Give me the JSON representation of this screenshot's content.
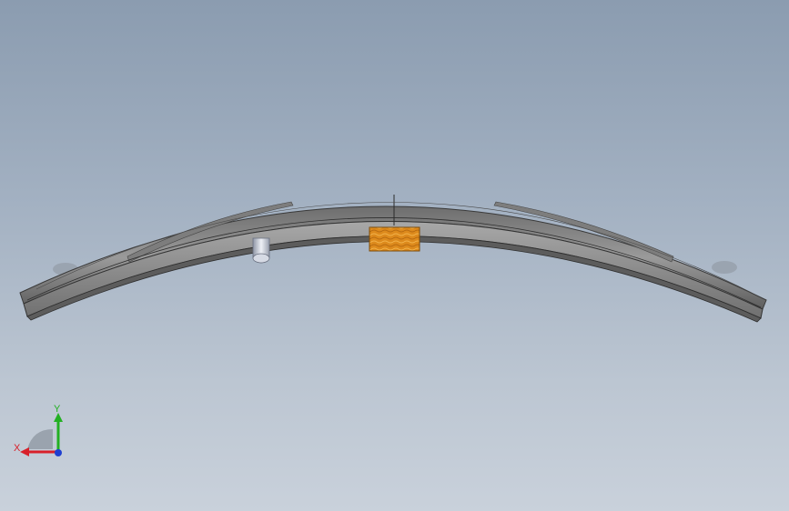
{
  "viewport": {
    "background_top": "#8b9cb0",
    "background_bottom": "#c9d1db"
  },
  "model": {
    "leaf_spring": "leaf-spring",
    "leaf_color": "#8a8a8a",
    "block_color": "#d9881e",
    "pin_color": "#c8ccd6"
  },
  "triad": {
    "x_label": "X",
    "y_label": "Y",
    "x_color": "#d8202a",
    "y_color": "#22b022",
    "z_color": "#1f3fd0"
  }
}
